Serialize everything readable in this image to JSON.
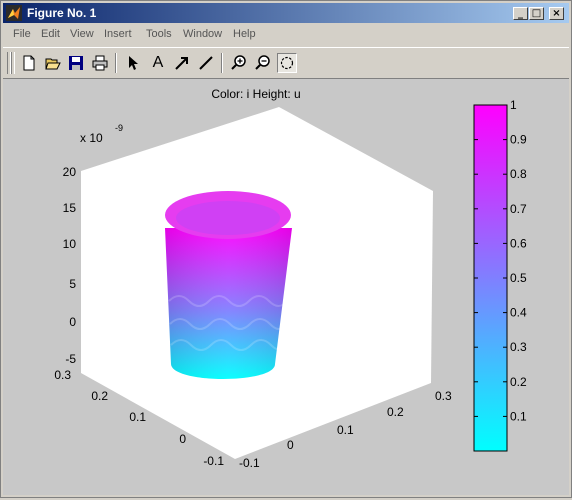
{
  "window": {
    "title": "Figure No. 1"
  },
  "window_buttons": {
    "minimize": "_",
    "maximize": "□",
    "close": "×"
  },
  "menu": [
    {
      "id": "file",
      "label": "File"
    },
    {
      "id": "edit",
      "label": "Edit"
    },
    {
      "id": "view",
      "label": "View"
    },
    {
      "id": "insert",
      "label": "Insert"
    },
    {
      "id": "tools",
      "label": "Tools"
    },
    {
      "id": "window",
      "label": "Window"
    },
    {
      "id": "help",
      "label": "Help"
    }
  ],
  "toolbar": {
    "icons": [
      "new-file-icon",
      "open-file-icon",
      "save-icon",
      "print-icon",
      "select-arrow-icon",
      "insert-text-icon",
      "insert-arrow-icon",
      "insert-line-icon",
      "zoom-in-icon",
      "zoom-out-icon",
      "rotate-3d-icon"
    ],
    "pressed": "rotate-3d-icon",
    "text_tool_label": "A"
  },
  "plot": {
    "title": "Color: i  Height: u",
    "z_exponent": "x 10",
    "z_exponent_power": "-9",
    "z_ticks": [
      "20",
      "15",
      "10",
      "5",
      "0",
      "-5"
    ],
    "y_ticks": [
      "0.3",
      "0.2",
      "0.1",
      "0",
      "-0.1"
    ],
    "x_ticks": [
      "-0.1",
      "0",
      "0.1",
      "0.2",
      "0.3"
    ],
    "colors": {
      "bottom": "#00ffff",
      "top": "#ff00ff",
      "background": "#c8c8c8",
      "axes_face": "#ffffff"
    }
  },
  "chart_data": {
    "type": "surface-3d",
    "title": "Color: i  Height: u",
    "colormap": "cool",
    "zlim": [
      -5e-09,
      2e-08
    ],
    "z_ticks": [
      2e-08,
      1.5e-08,
      1e-08,
      5e-09,
      0,
      -5e-09
    ],
    "x_ticks": [
      -0.1,
      0,
      0.1,
      0.2,
      0.3
    ],
    "y_ticks": [
      0.3,
      0.2,
      0.1,
      0,
      -0.1
    ]
  },
  "colorbar": {
    "ticks": [
      "1",
      "0.9",
      "0.8",
      "0.7",
      "0.6",
      "0.5",
      "0.4",
      "0.3",
      "0.2",
      "0.1"
    ],
    "values": [
      1,
      0.9,
      0.8,
      0.7,
      0.6,
      0.5,
      0.4,
      0.3,
      0.2,
      0.1
    ],
    "range": [
      0,
      1
    ]
  }
}
